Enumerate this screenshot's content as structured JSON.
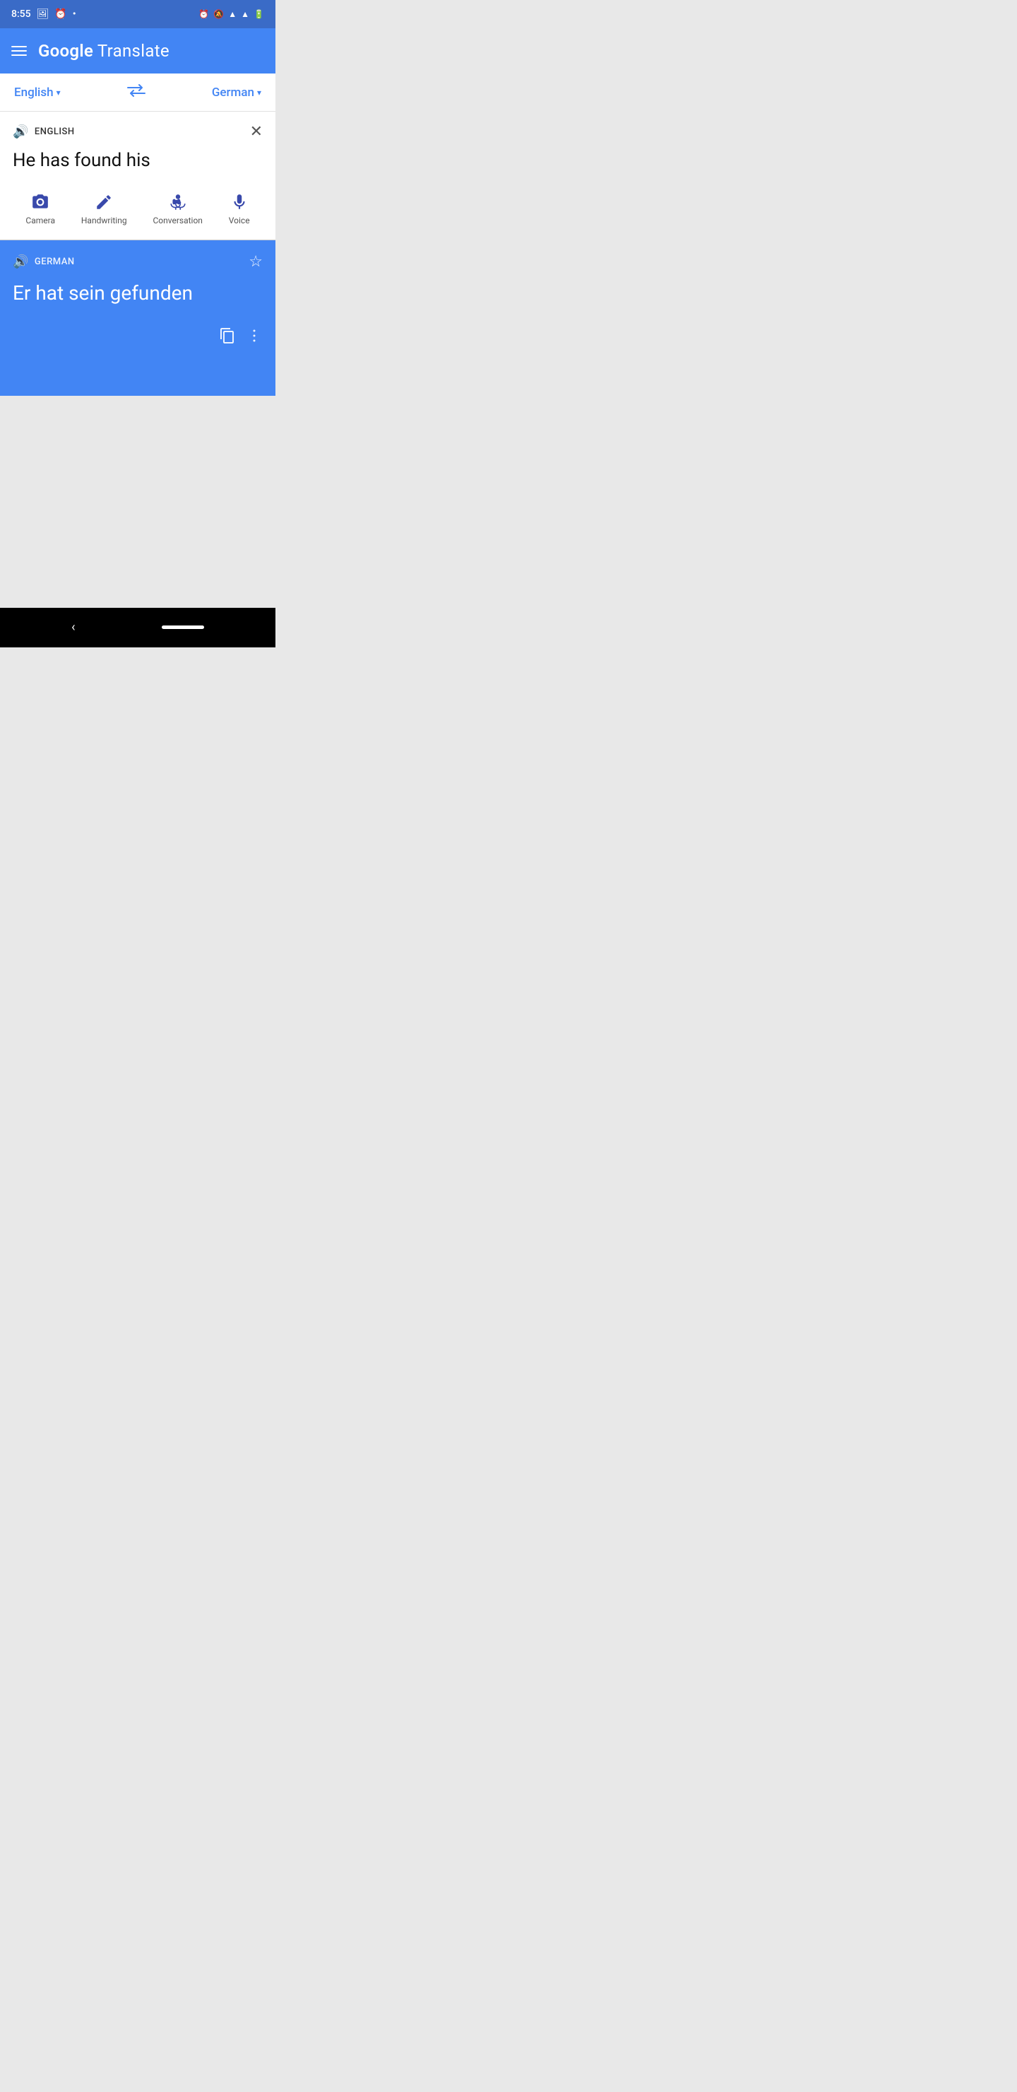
{
  "statusBar": {
    "time": "8:55",
    "icons": [
      "photo",
      "alarm",
      "dot",
      "alarm-right",
      "mute",
      "wifi",
      "signal",
      "battery"
    ]
  },
  "appBar": {
    "title": "Google Translate",
    "titleGoogle": "Google",
    "titleTranslate": " Translate"
  },
  "languageBar": {
    "sourceLang": "English",
    "targetLang": "German",
    "swapLabel": "⇄"
  },
  "inputSection": {
    "langLabel": "ENGLISH",
    "inputText": "He has found his",
    "tools": [
      {
        "id": "camera",
        "label": "Camera"
      },
      {
        "id": "handwriting",
        "label": "Handwriting"
      },
      {
        "id": "conversation",
        "label": "Conversation"
      },
      {
        "id": "voice",
        "label": "Voice"
      }
    ]
  },
  "translationSection": {
    "langLabel": "GERMAN",
    "translatedText": "Er hat sein gefunden"
  },
  "navBar": {
    "backLabel": "‹"
  }
}
